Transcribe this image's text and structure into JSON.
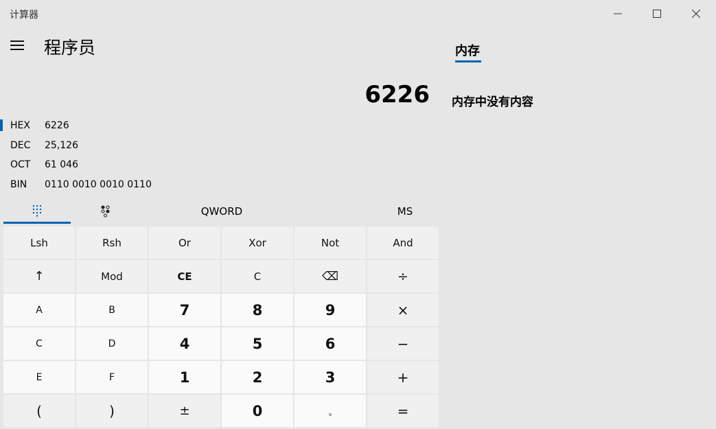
{
  "app": {
    "title": "计算器",
    "mode": "程序员"
  },
  "window": {
    "minimize_icon": "minimize-icon",
    "maximize_icon": "maximize-icon",
    "close_icon": "close-icon"
  },
  "memory": {
    "tab_label": "内存",
    "empty_text": "内存中没有内容"
  },
  "display": {
    "value": "6226"
  },
  "radix": [
    {
      "label": "HEX",
      "value": "6226"
    },
    {
      "label": "DEC",
      "value": "25,126"
    },
    {
      "label": "OCT",
      "value": "61 046"
    },
    {
      "label": "BIN",
      "value": "0110 0010 0010 0110"
    }
  ],
  "tabs": {
    "word_size": "QWORD",
    "ms": "MS"
  },
  "keys": {
    "lsh": "Lsh",
    "rsh": "Rsh",
    "or": "Or",
    "xor": "Xor",
    "not": "Not",
    "and": "And",
    "shift": "↑",
    "mod": "Mod",
    "ce": "CE",
    "c": "C",
    "backspace": "⌫",
    "divide": "÷",
    "a": "A",
    "b": "B",
    "seven": "7",
    "eight": "8",
    "nine": "9",
    "multiply": "×",
    "hex_c": "C",
    "d": "D",
    "four": "4",
    "five": "5",
    "six": "6",
    "minus": "−",
    "e": "E",
    "f": "F",
    "one": "1",
    "two": "2",
    "three": "3",
    "plus": "+",
    "lparen": "(",
    "rparen": ")",
    "negate": "±",
    "zero": "0",
    "decimal": ".",
    "equals": "="
  },
  "colors": {
    "accent": "#0063b1",
    "background": "#e6e6e6"
  }
}
